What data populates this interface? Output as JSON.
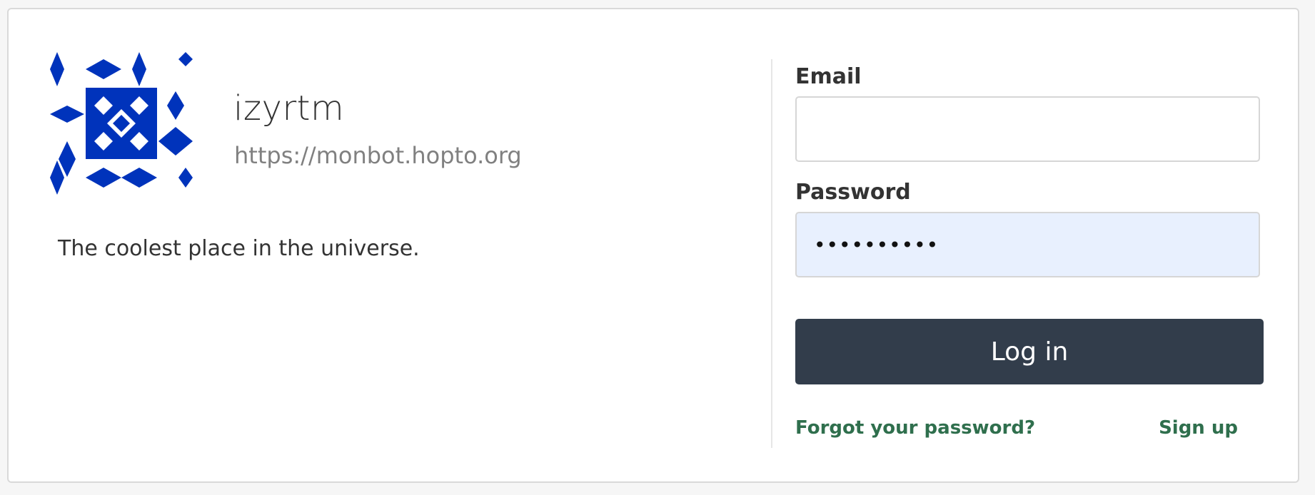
{
  "site": {
    "name": "izyrtm",
    "url": "https://monbot.hopto.org",
    "description": "The coolest place in the universe."
  },
  "login": {
    "email_label": "Email",
    "email_value": "",
    "password_label": "Password",
    "password_value": "••••••••••",
    "submit_label": "Log in",
    "forgot_label": "Forgot your password?",
    "signup_label": "Sign up"
  },
  "colors": {
    "background": "#f6f6f6",
    "card_background": "#ffffff",
    "card_border": "#d9d9d9",
    "primary_text": "#333333",
    "secondary_text": "#808080",
    "input_border": "#d6d6d6",
    "autofill_background": "#e8f0fe",
    "button_background": "#323d4b",
    "button_text": "#ffffff",
    "link_color": "#2f6f4d",
    "avatar_blue": "#0033bb"
  },
  "icons": {
    "avatar": "identicon-avatar"
  }
}
